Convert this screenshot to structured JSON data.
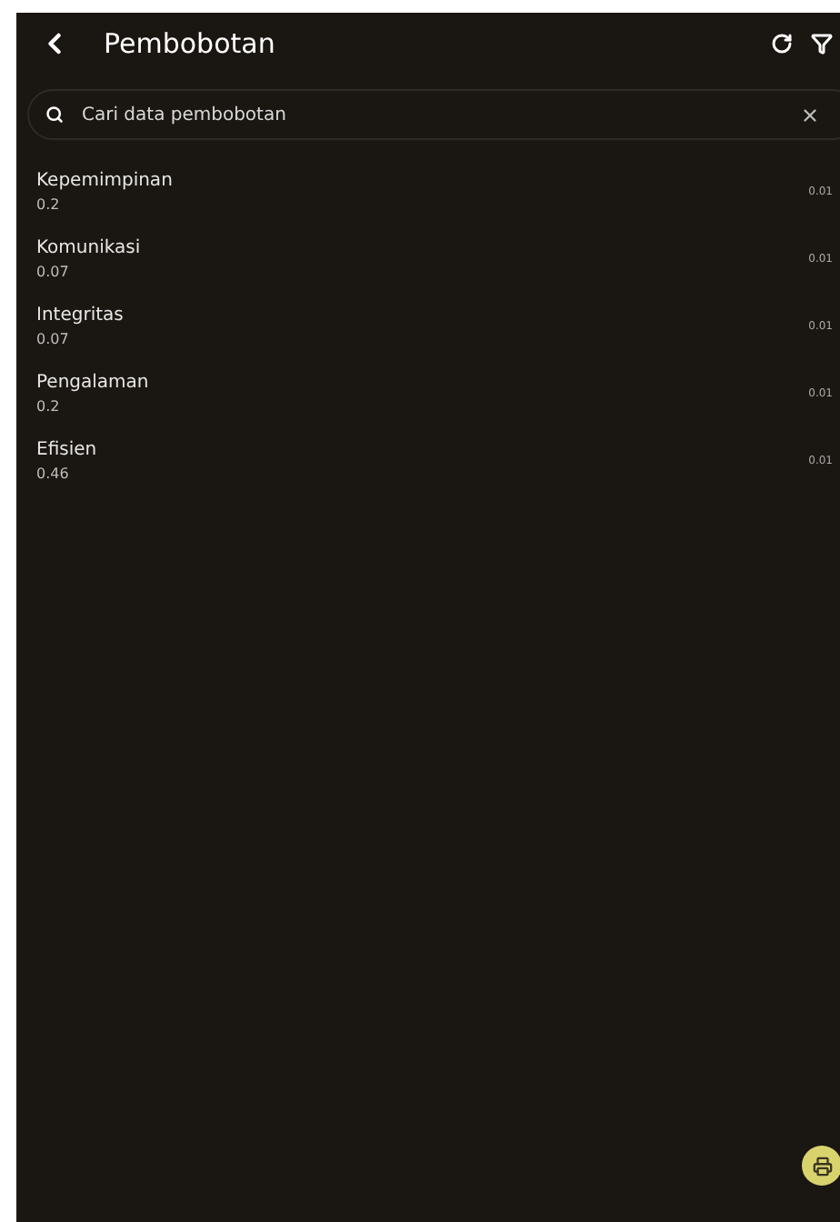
{
  "header": {
    "title": "Pembobotan"
  },
  "search": {
    "placeholder": "Cari data pembobotan"
  },
  "items": [
    {
      "name": "Kepemimpinan",
      "value": "0.2",
      "trailing": "0.01"
    },
    {
      "name": "Komunikasi",
      "value": "0.07",
      "trailing": "0.01"
    },
    {
      "name": "Integritas",
      "value": "0.07",
      "trailing": "0.01"
    },
    {
      "name": "Pengalaman",
      "value": "0.2",
      "trailing": "0.01"
    },
    {
      "name": "Efisien",
      "value": "0.46",
      "trailing": "0.01"
    }
  ]
}
